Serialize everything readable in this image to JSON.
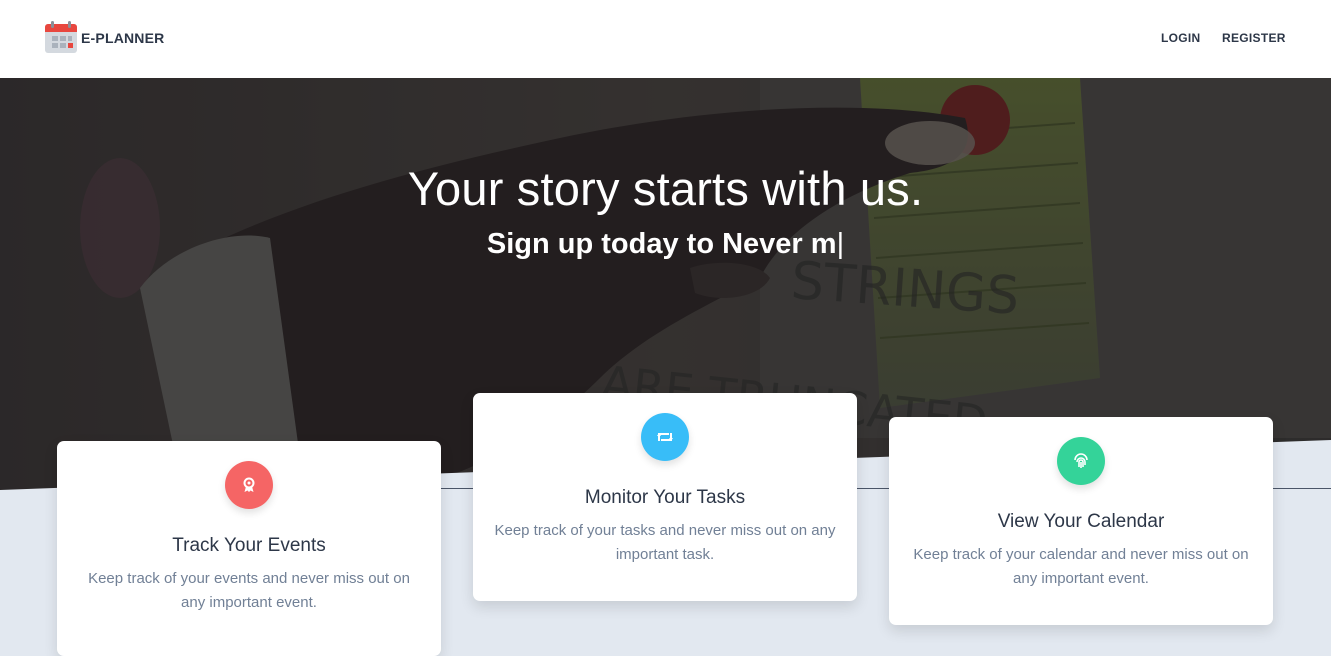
{
  "brand": {
    "name": "E-PLANNER",
    "icon": "calendar-icon"
  },
  "nav": {
    "login": "LOGIN",
    "register": "REGISTER"
  },
  "hero": {
    "title": "Your story starts with us.",
    "subtitle": "Sign up today to Never m",
    "cursor": "|"
  },
  "cards": [
    {
      "title": "Track Your Events",
      "text": "Keep track of your events and never miss out on any important event.",
      "icon": "award-icon",
      "color": "#f56565"
    },
    {
      "title": "Monitor Your Tasks",
      "text": "Keep track of your tasks and never miss out on any important task.",
      "icon": "retweet-icon",
      "color": "#38bdf8"
    },
    {
      "title": "View Your Calendar",
      "text": "Keep track of your calendar and never miss out on any important event.",
      "icon": "fingerprint-icon",
      "color": "#34d399"
    }
  ]
}
